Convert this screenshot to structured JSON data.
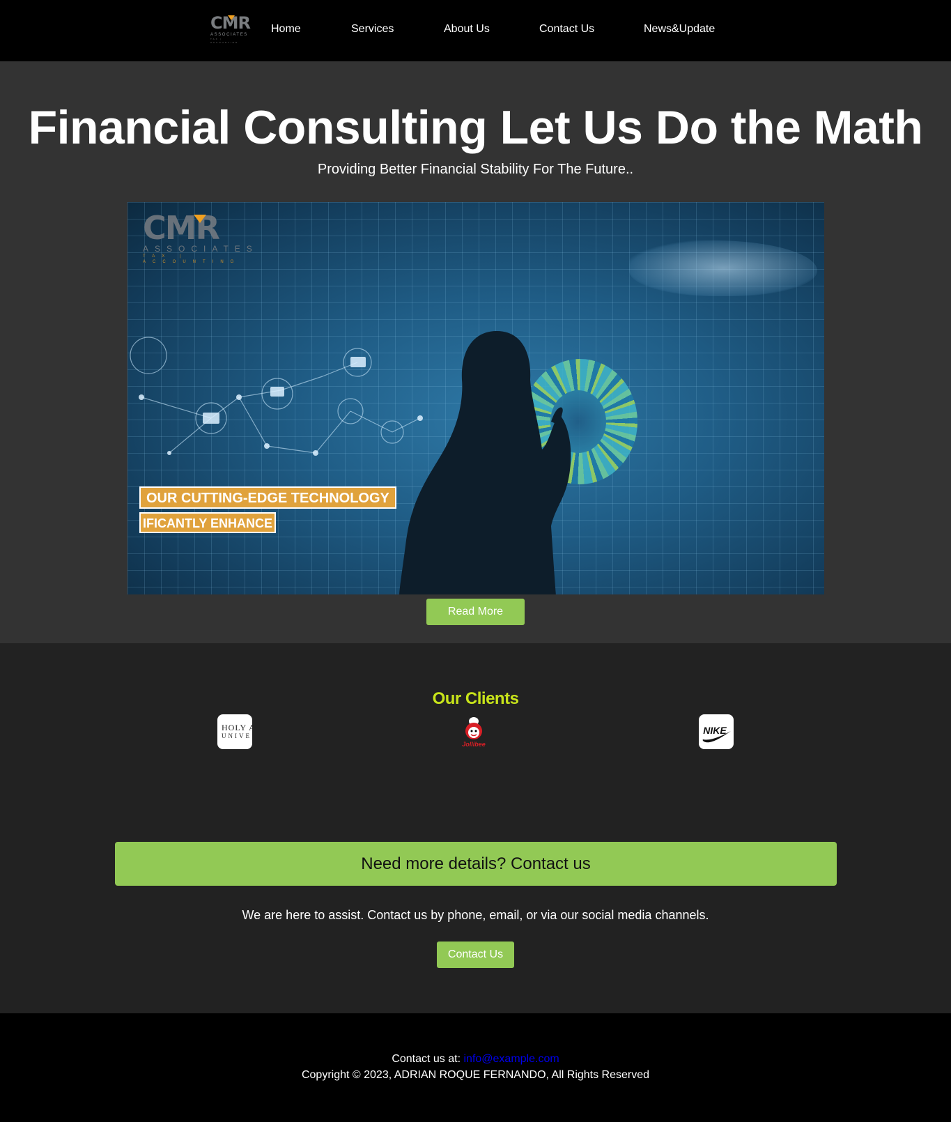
{
  "header": {
    "logo": {
      "main": "CMR",
      "sub": "ASSOCIATES",
      "tagline": "TAX | ACCOUNTING"
    },
    "nav": [
      "Home",
      "Services",
      "About Us",
      "Contact Us",
      "News&Update"
    ]
  },
  "hero": {
    "title": "Financial Consulting Let Us Do the Math",
    "subtitle": "Providing Better Financial Stability For The Future..",
    "image": {
      "logo_main": "CMR",
      "logo_sub": "ASSOCIATES",
      "logo_tagline": "TAX | ACCOUNTING",
      "banner_line1": "OUR CUTTING-EDGE TECHNOLOGY",
      "banner_line2": "IFICANTLY ENHANCE"
    },
    "read_more_label": "Read More"
  },
  "clients": {
    "title": "Our Clients",
    "logos": [
      {
        "name": "holy-angel",
        "line1": "HOLY A",
        "line2": "UNIVE"
      },
      {
        "name": "jollibee",
        "text": "Jollibee"
      },
      {
        "name": "nike",
        "text": "NIKE"
      }
    ]
  },
  "contact_cta": {
    "heading": "Need more details? Contact us",
    "text": "We are here to assist. Contact us by phone, email, or via our social media channels.",
    "button_label": "Contact Us"
  },
  "footer": {
    "contact_prefix": "Contact us at: ",
    "email": "info@example.com",
    "copyright": "Copyright © 2023, ADRIAN ROQUE FERNANDO, All Rights Reserved"
  },
  "colors": {
    "accent_green": "#92c955",
    "clients_title": "#c8e41a",
    "banner_orange": "#e0a23c",
    "link_blue": "#0000ee"
  }
}
